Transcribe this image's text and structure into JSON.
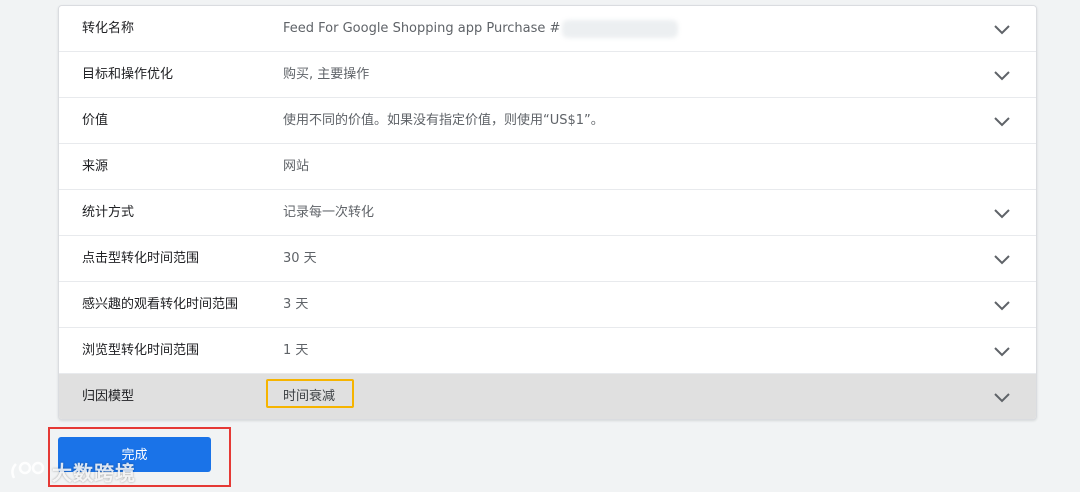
{
  "settings": {
    "rows": [
      {
        "label": "转化名称",
        "value": "Feed For Google Shopping app Purchase #",
        "has_chevron": true,
        "redacted": true
      },
      {
        "label": "目标和操作优化",
        "value": "购买, 主要操作",
        "has_chevron": true
      },
      {
        "label": "价值",
        "value": "使用不同的价值。如果没有指定价值，则使用“US$1”。",
        "has_chevron": true
      },
      {
        "label": "来源",
        "value": "网站",
        "has_chevron": false
      },
      {
        "label": "统计方式",
        "value": "记录每一次转化",
        "has_chevron": true
      },
      {
        "label": "点击型转化时间范围",
        "value": "30 天",
        "has_chevron": true
      },
      {
        "label": "感兴趣的观看转化时间范围",
        "value": "3 天",
        "has_chevron": true
      },
      {
        "label": "浏览型转化时间范围",
        "value": "1 天",
        "has_chevron": true
      },
      {
        "label": "归因模型",
        "value": "时间衰减",
        "has_chevron": true,
        "selected": true
      }
    ]
  },
  "actions": {
    "done_label": "完成"
  },
  "watermark": {
    "text": "大数跨境"
  },
  "colors": {
    "primary_button": "#1a73e8",
    "highlight_value_border": "#f6b400",
    "highlight_button_border": "#e53935",
    "selected_row": "#e0e0e0"
  }
}
